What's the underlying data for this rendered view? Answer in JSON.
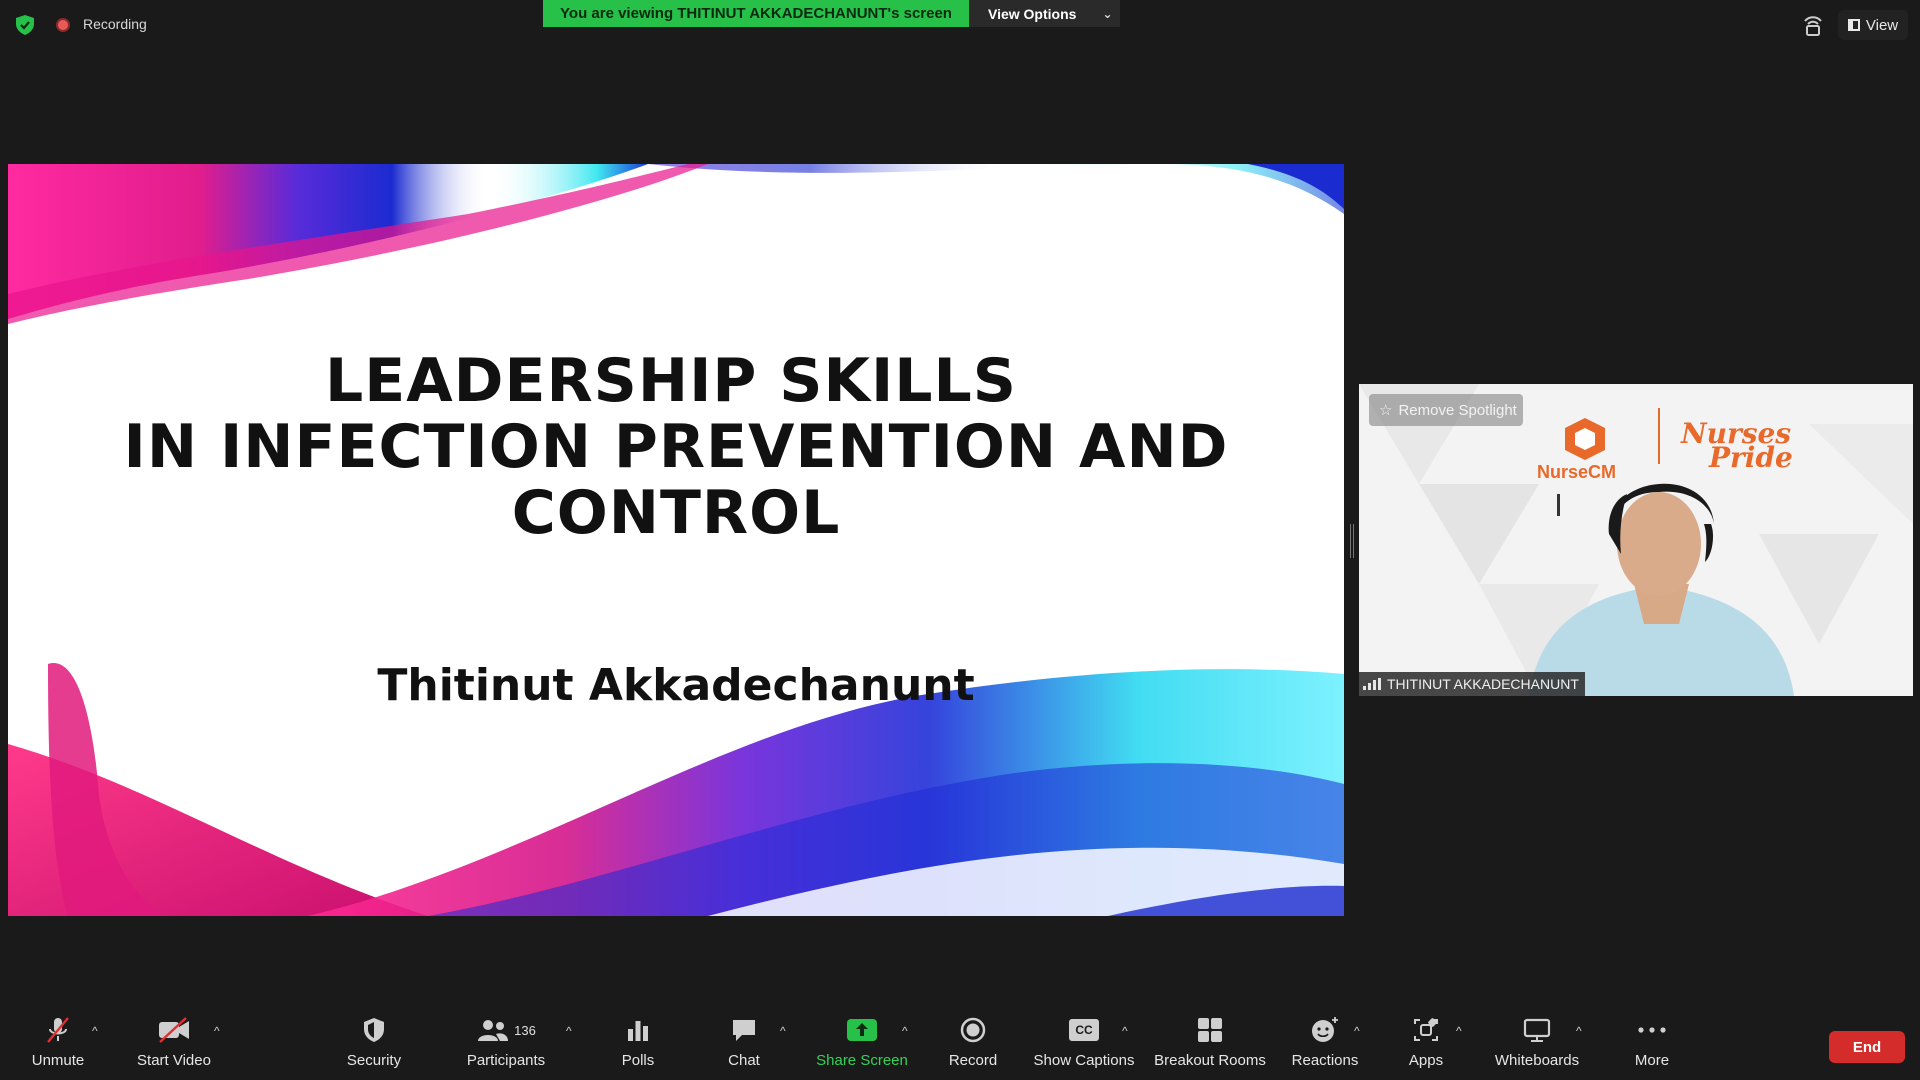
{
  "top_bar": {
    "recording_label": "Recording",
    "viewing_banner": "You are viewing THITINUT AKKADECHANUNT's screen",
    "view_options_label": "View Options",
    "view_label": "View"
  },
  "slide": {
    "title_line1": "LEADERSHIP SKILLS",
    "title_line2": "IN INFECTION PREVENTION AND",
    "title_line3": "CONTROL",
    "author": "Thitinut Akkadechanunt"
  },
  "video_tile": {
    "spotlight_label": "Remove Spotlight",
    "participant_name": "THITINUT AKKADECHANUNT",
    "logo_text": "NurseCM",
    "pride_text_1": "Nurses",
    "pride_text_2": "Pride"
  },
  "toolbar": {
    "unmute": "Unmute",
    "start_video": "Start Video",
    "security": "Security",
    "participants": "Participants",
    "participants_count": "136",
    "polls": "Polls",
    "chat": "Chat",
    "share_screen": "Share Screen",
    "record": "Record",
    "show_captions": "Show Captions",
    "captions_icon_text": "CC",
    "breakout_rooms": "Breakout Rooms",
    "reactions": "Reactions",
    "apps": "Apps",
    "whiteboards": "Whiteboards",
    "more": "More",
    "end": "End"
  },
  "colors": {
    "banner_green": "#27c14a",
    "share_green": "#35d15a",
    "end_red": "#d42b2b",
    "background": "#1a1a1a"
  }
}
